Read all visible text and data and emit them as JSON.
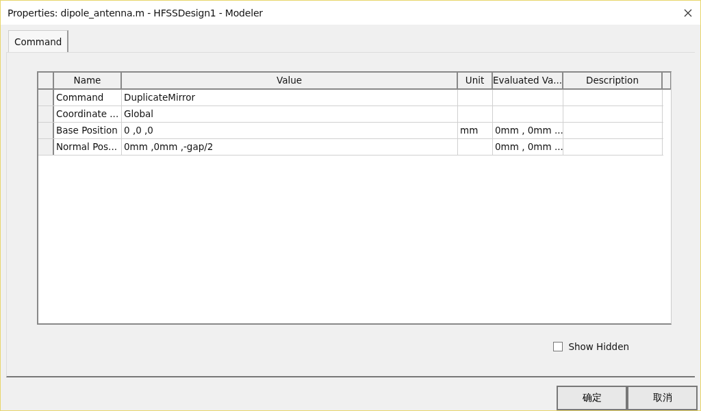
{
  "window": {
    "title": "Properties: dipole_antenna.m - HFSSDesign1 - Modeler"
  },
  "tabs": [
    {
      "label": "Command",
      "selected": true
    }
  ],
  "table": {
    "columns": [
      "Name",
      "Value",
      "Unit",
      "Evaluated Va...",
      "Description"
    ],
    "rows": [
      {
        "cells": [
          "Command",
          "DuplicateMirror",
          "",
          "",
          ""
        ]
      },
      {
        "cells": [
          "Coordinate ...",
          "Global",
          "",
          "",
          ""
        ]
      },
      {
        "cells": [
          "Base Position",
          "0 ,0 ,0",
          "mm",
          "0mm , 0mm ...",
          ""
        ]
      },
      {
        "cells": [
          "Normal Pos...",
          "0mm ,0mm ,-gap/2",
          "",
          "0mm , 0mm ...",
          ""
        ]
      }
    ]
  },
  "show_hidden": {
    "label": "Show Hidden",
    "checked": false
  },
  "buttons": [
    "确定",
    "取消"
  ]
}
